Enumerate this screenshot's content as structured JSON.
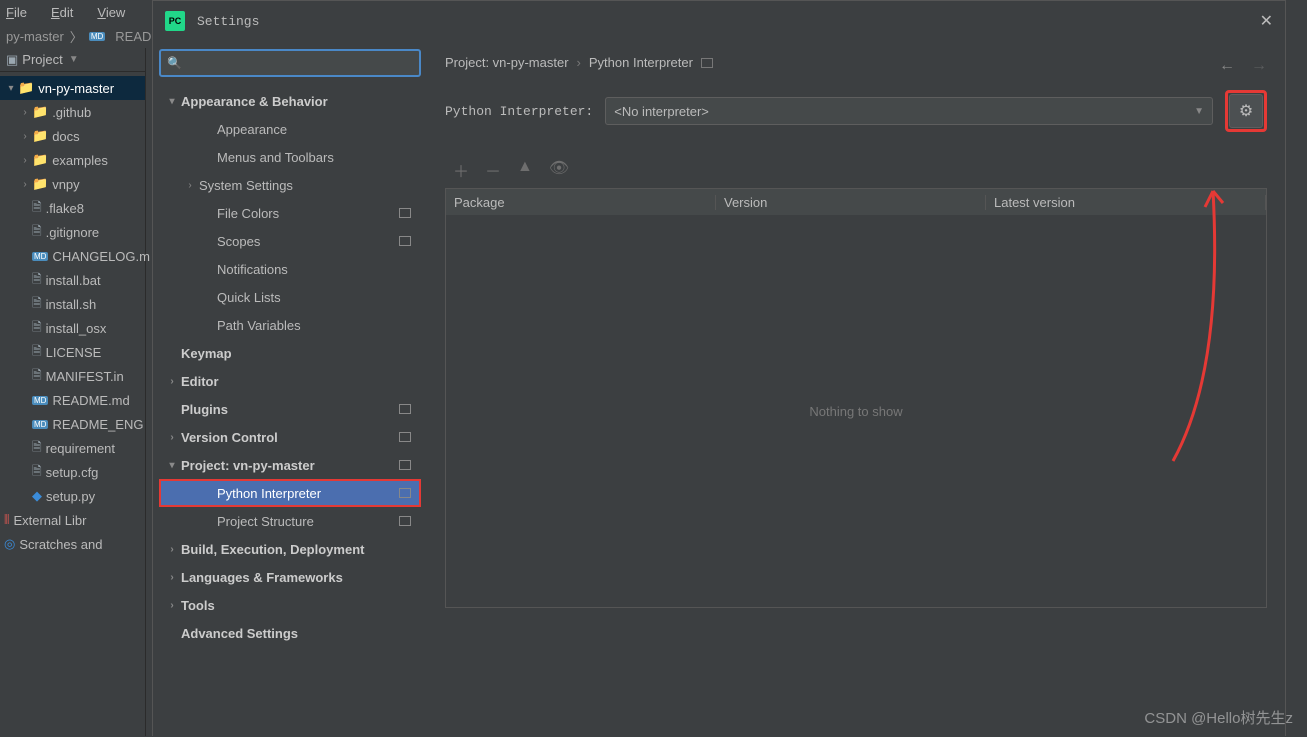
{
  "menubar": [
    {
      "key": "F",
      "label": "ile"
    },
    {
      "key": "E",
      "label": "dit"
    },
    {
      "key": "V",
      "label": "iew"
    }
  ],
  "breadcrumb_top": "py-master",
  "breadcrumb_file": "READ",
  "project": {
    "header": "Project",
    "root": "vn-py-master",
    "folders": [
      ".github",
      "docs",
      "examples",
      "vnpy"
    ],
    "files": [
      {
        "name": ".flake8",
        "ico": "file"
      },
      {
        "name": ".gitignore",
        "ico": "file"
      },
      {
        "name": "CHANGELOG.m",
        "ico": "md"
      },
      {
        "name": "install.bat",
        "ico": "file"
      },
      {
        "name": "install.sh",
        "ico": "file"
      },
      {
        "name": "install_osx",
        "ico": "file"
      },
      {
        "name": "LICENSE",
        "ico": "file"
      },
      {
        "name": "MANIFEST.in",
        "ico": "file"
      },
      {
        "name": "README.md",
        "ico": "md"
      },
      {
        "name": "README_ENG",
        "ico": "md"
      },
      {
        "name": "requirement",
        "ico": "file"
      },
      {
        "name": "setup.cfg",
        "ico": "file"
      },
      {
        "name": "setup.py",
        "ico": "py"
      }
    ],
    "external": "External Libr",
    "scratches": "Scratches and"
  },
  "dialog": {
    "title": "Settings",
    "search_placeholder": "",
    "tree": [
      {
        "label": "Appearance & Behavior",
        "bold": true,
        "chev": "v",
        "lvl": 0
      },
      {
        "label": "Appearance",
        "lvl": 2
      },
      {
        "label": "Menus and Toolbars",
        "lvl": 2
      },
      {
        "label": "System Settings",
        "chev": ">",
        "lvl": 1
      },
      {
        "label": "File Colors",
        "lvl": 2,
        "box": true
      },
      {
        "label": "Scopes",
        "lvl": 2,
        "box": true
      },
      {
        "label": "Notifications",
        "lvl": 2
      },
      {
        "label": "Quick Lists",
        "lvl": 2
      },
      {
        "label": "Path Variables",
        "lvl": 2
      },
      {
        "label": "Keymap",
        "bold": true,
        "lvl": 0,
        "noarrow": true
      },
      {
        "label": "Editor",
        "bold": true,
        "chev": ">",
        "lvl": 0
      },
      {
        "label": "Plugins",
        "bold": true,
        "lvl": 0,
        "noarrow": true,
        "box": true
      },
      {
        "label": "Version Control",
        "bold": true,
        "chev": ">",
        "lvl": 0,
        "box": true
      },
      {
        "label": "Project: vn-py-master",
        "bold": true,
        "chev": "v",
        "lvl": 0,
        "box": true
      },
      {
        "label": "Python Interpreter",
        "lvl": 2,
        "sel": true,
        "hl": true,
        "box": true
      },
      {
        "label": "Project Structure",
        "lvl": 2,
        "box": true
      },
      {
        "label": "Build, Execution, Deployment",
        "bold": true,
        "chev": ">",
        "lvl": 0
      },
      {
        "label": "Languages & Frameworks",
        "bold": true,
        "chev": ">",
        "lvl": 0
      },
      {
        "label": "Tools",
        "bold": true,
        "chev": ">",
        "lvl": 0
      },
      {
        "label": "Advanced Settings",
        "bold": true,
        "lvl": 0,
        "noarrow": true
      }
    ],
    "crumb_project": "Project: vn-py-master",
    "crumb_page": "Python Interpreter",
    "interpreter_label": "Python Interpreter:",
    "interpreter_value": "<No interpreter>",
    "pkg_headers": [
      "Package",
      "Version",
      "Latest version"
    ],
    "nothing": "Nothing to show",
    "watermark": "CSDN @Hello树先生z"
  }
}
